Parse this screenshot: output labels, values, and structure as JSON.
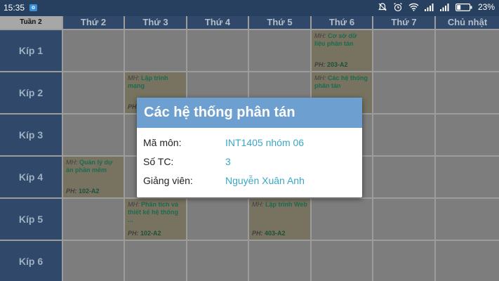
{
  "status_bar": {
    "time": "15:35",
    "notification_badge": "o",
    "battery_percent": "23%"
  },
  "week_label": "Tuần 2",
  "days": [
    "Thứ 2",
    "Thứ 3",
    "Thứ 4",
    "Thứ 5",
    "Thứ 6",
    "Thứ 7",
    "Chủ nhật"
  ],
  "periods": [
    "Kíp 1",
    "Kíp 2",
    "Kíp 3",
    "Kíp 4",
    "Kíp 5",
    "Kíp 6"
  ],
  "courses": [
    {
      "prefix": "MH:",
      "name": "Cơ sở dữ liệu phân tán",
      "room_prefix": "PH:",
      "room": "203-A2"
    },
    {
      "prefix": "MH:",
      "name": "Lập trình mạng",
      "room_prefix": "PH:",
      "room": ""
    },
    {
      "prefix": "MH:",
      "name": "Các hệ thống phân tán",
      "room_prefix": "",
      "room": ""
    },
    {
      "prefix": "MH:",
      "name": "Quản lý dự án phần mềm",
      "room_prefix": "PH:",
      "room": "102-A2"
    },
    {
      "prefix": "MH:",
      "name": "Phân tích và thiết kế hệ thống ...",
      "room_prefix": "PH:",
      "room": "102-A2"
    },
    {
      "prefix": "MH:",
      "name": "Lập trình Web",
      "room_prefix": "PH:",
      "room": "403-A2"
    }
  ],
  "dialog": {
    "title": "Các hệ thống phân tán",
    "rows": [
      {
        "label": "Mã môn:",
        "value": "INT1405 nhóm 06"
      },
      {
        "label": "Số TC:",
        "value": "3"
      },
      {
        "label": "Giảng viên:",
        "value": "Nguyễn Xuân Anh"
      }
    ]
  },
  "colors": {
    "header_bg": "#30496a",
    "dialog_title_bg": "#6d9fd1",
    "dialog_value": "#3aa7c4",
    "course_name": "#1d6a4f"
  }
}
